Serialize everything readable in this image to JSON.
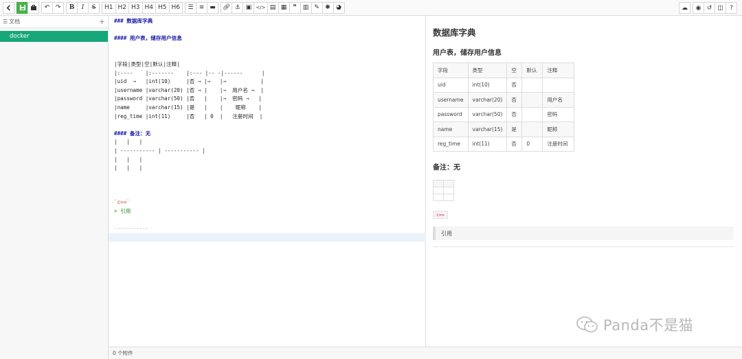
{
  "toolbar": {
    "h_labels": [
      "H1",
      "H2",
      "H3",
      "H4",
      "H5",
      "H6"
    ],
    "bold": "B",
    "italic": "I",
    "strike": "S"
  },
  "sidebar": {
    "header_label": "文档",
    "add_label": "+",
    "items": [
      {
        "label": "docker"
      }
    ]
  },
  "editor": {
    "lines": [
      "### 数据库字典",
      "",
      "#### 用户表，储存用户信息",
      "",
      "",
      "|字段|类型|空|默认|注释|",
      "|:----    |:-------    |:--- |-- -|------      |",
      "|uid  →   |int(10)     |否 → |→   |→           |",
      "|username |varchar(20) |否 → |    |→  用户名 →  |",
      "|password |varchar(50) |否   |    |→  密码 →   |",
      "|name     |varchar(15) |是   |    |    昵称    |",
      "|reg_time |int(11)     |否   | 0  |   注册时间  |",
      "",
      "#### 备注：无",
      "|   |   |",
      "| ----------- | ----------- |",
      "|   |   |",
      "|   |   |",
      "",
      "",
      "",
      "`c==`",
      "> 引用",
      "",
      "-----------",
      "",
      ""
    ]
  },
  "preview": {
    "title": "数据库字典",
    "subtitle": "用户表，储存用户信息",
    "table": {
      "headers": [
        "字段",
        "类型",
        "空",
        "默认",
        "注释"
      ],
      "rows": [
        [
          "uid",
          "int(10)",
          "否",
          "",
          ""
        ],
        [
          "username",
          "varchar(20)",
          "否",
          "",
          "用户名"
        ],
        [
          "password",
          "varchar(50)",
          "否",
          "",
          "密码"
        ],
        [
          "name",
          "varchar(15)",
          "是",
          "",
          "昵称"
        ],
        [
          "reg_time",
          "int(11)",
          "否",
          "0",
          "注册时间"
        ]
      ]
    },
    "note": "备注：无",
    "code": "c==",
    "quote": "引用"
  },
  "footer": {
    "attachments": "0 个附件"
  },
  "watermark": {
    "text": "Panda不是猫"
  },
  "colors": {
    "accent": "#44b549",
    "sidebar_active": "#17a77a"
  }
}
